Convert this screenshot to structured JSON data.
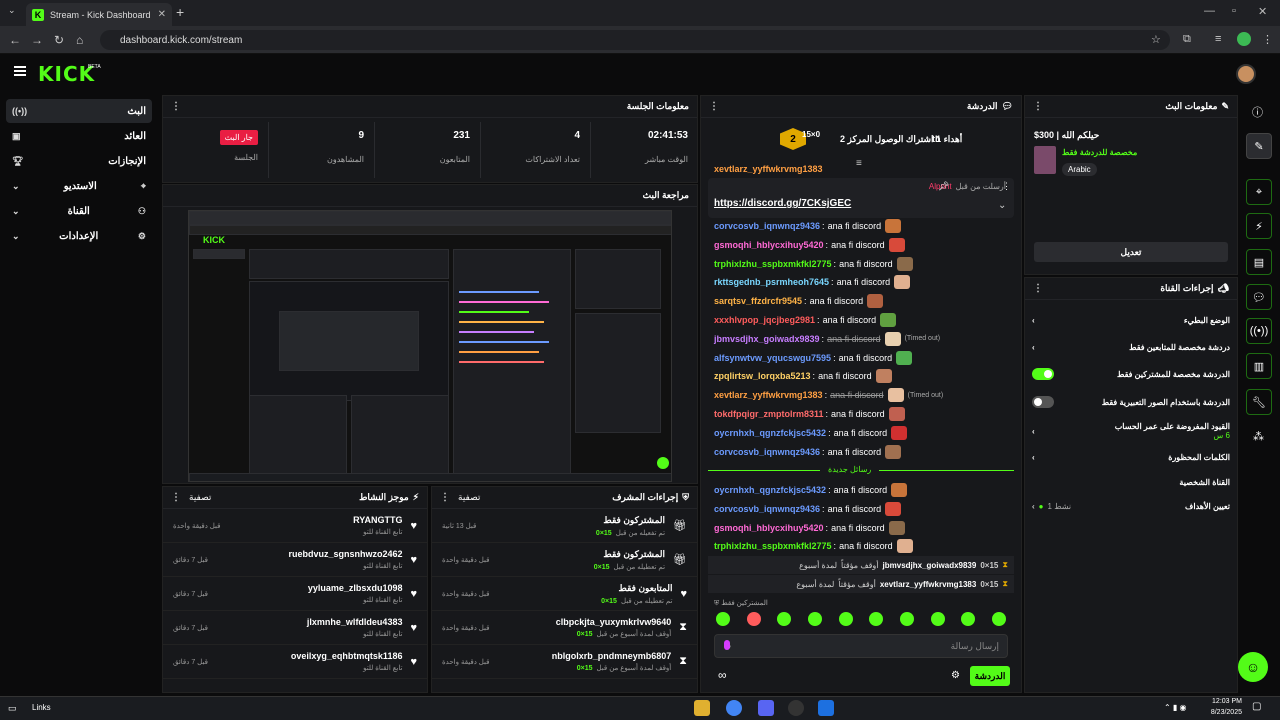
{
  "browser": {
    "tab_title": "Stream - Kick Dashboard",
    "url": "dashboard.kick.com/stream"
  },
  "app": {
    "logo": "KICK",
    "beta": "BETA"
  },
  "sidebar": {
    "items": [
      {
        "label": "البث",
        "icon": "broadcast-icon"
      },
      {
        "label": "العائد",
        "icon": "wallet-icon"
      },
      {
        "label": "الإنجازات",
        "icon": "trophy-icon"
      },
      {
        "label": "الاستديو",
        "icon": "studio-icon"
      },
      {
        "label": "القناة",
        "icon": "channel-icon"
      },
      {
        "label": "الإعدادات",
        "icon": "gear-icon"
      }
    ]
  },
  "session": {
    "title": "معلومات الجلسة",
    "live_badge": "جار البث",
    "stats": [
      {
        "value": "",
        "label": "الجلسة"
      },
      {
        "value": "9",
        "label": "المشاهدون"
      },
      {
        "value": "231",
        "label": "المتابعون"
      },
      {
        "value": "4",
        "label": "تعداد الاشتراكات"
      },
      {
        "value": "02:41:53",
        "label": "الوقت مباشر"
      }
    ]
  },
  "preview": {
    "title": "مراجعة البث"
  },
  "activity": {
    "title": "موجز النشاط",
    "filter": "تصفية",
    "rows": [
      {
        "name": "RYANGTTG",
        "sub": "تابع القناة للتو",
        "time": "قبل دقيقة واحدة"
      },
      {
        "name": "ruebdvuz_sgnsnhwzo2462",
        "sub": "تابع القناة للتو",
        "time": "قبل 7 دقائق"
      },
      {
        "name": "yyluame_zlbsxdu1098",
        "sub": "تابع القناة للتو",
        "time": "قبل 7 دقائق"
      },
      {
        "name": "jlxmnhe_wlfdldeu4383",
        "sub": "تابع القناة للتو",
        "time": "قبل 7 دقائق"
      },
      {
        "name": "oveilxyg_eqhbtmqtsk1186",
        "sub": "تابع القناة للتو",
        "time": "قبل 7 دقائق"
      }
    ]
  },
  "modactions": {
    "title": "إجراءات المشرف",
    "filter": "تصفية",
    "rows": [
      {
        "name": "المشتركون فقط",
        "tag": "15×0",
        "sub": "تم تفعيله من قبل",
        "time": "قبل 13 ثانية",
        "icon": "gift-icon"
      },
      {
        "name": "المشتركون فقط",
        "tag": "15×0",
        "sub": "تم تعطيله من قبل",
        "time": "قبل دقيقة واحدة",
        "icon": "gift-icon"
      },
      {
        "name": "المتابعون فقط",
        "tag": "15×0",
        "sub": "تم تعطيله من قبل",
        "time": "قبل دقيقة واحدة",
        "icon": "heart-icon"
      },
      {
        "name": "clbpckjta_yuxymkrlvw9640",
        "tag": "15×0",
        "sub": "أوقف لمدة أسبوع من قبل",
        "time": "قبل دقيقة واحدة",
        "icon": "hourglass-icon"
      },
      {
        "name": "nblgolxrb_pndmneymb6807",
        "tag": "15×0",
        "sub": "أوقف لمدة أسبوع من قبل",
        "time": "قبل دقيقة واحدة",
        "icon": "hourglass-icon"
      }
    ]
  },
  "chat": {
    "title": "الدردشة",
    "goal_text": "أهداء 1 اشتراك الوصول المركز 2",
    "goal_level": "2",
    "goal_tag": "15×0",
    "goal_suffix": "th",
    "pinned_by": "أرسلت من قبل",
    "pinned_user": "Alpont",
    "pinned_link": "https://discord.gg/7CKsjGEC",
    "message_text": "ana fi discord",
    "timed_out": "(Timed out)",
    "messages": [
      {
        "user": "corvcosvb_iqnwnqz9436",
        "color": "#6c9bff"
      },
      {
        "user": "gsmoqhi_hblycxihuy5420",
        "color": "#ff6ad5"
      },
      {
        "user": "trphixlzhu_sspbxmkfkl2775",
        "color": "#53fc18"
      },
      {
        "user": "rkttsgednb_psrmheoh7645",
        "color": "#7ad7ff"
      },
      {
        "user": "sarqtsv_ffzdrcfr9545",
        "color": "#ffb347"
      },
      {
        "user": "xxxhlvpop_jqcjbeg2981",
        "color": "#ff5c5c"
      },
      {
        "user": "jbmvsdjhx_goiwadx9839",
        "color": "#c77dff"
      },
      {
        "user": "alfsynwtvw_yqucswgu7595",
        "color": "#6c9bff"
      },
      {
        "user": "zpqlirtsw_lorqxba5213",
        "color": "#ffd166"
      },
      {
        "user": "xevtlarz_yyffwkrvmg1383",
        "color": "#ff9f43"
      },
      {
        "user": "tokdfpqigr_zmptolrm8311",
        "color": "#ff6b6b"
      },
      {
        "user": "oycrnhxh_qgnzfckjsc5432",
        "color": "#6c9bff"
      },
      {
        "user": "corvcosvb_iqnwnqz9436",
        "color": "#6c9bff"
      }
    ],
    "new_messages": "رسائل جديدة",
    "messages_new": [
      {
        "user": "oycrnhxh_qgnzfckjsc5432",
        "color": "#6c9bff"
      },
      {
        "user": "corvcosvb_iqnwnqz9436",
        "color": "#6c9bff"
      },
      {
        "user": "gsmoqhi_hblycxihuy5420",
        "color": "#ff6ad5"
      },
      {
        "user": "trphixlzhu_sspbxmkfkl2775",
        "color": "#53fc18"
      }
    ],
    "sys1": {
      "text": "أوقف مؤقتاً",
      "user": "jbmvsdjhx_goiwadx9839",
      "dur": "لمدة أسبوع",
      "tag": "15×0"
    },
    "sys2": {
      "text": "أوقف مؤقتاً",
      "user": "xevtlarz_yyffwkrvmg1383",
      "dur": "لمدة أسبوع",
      "tag": "15×0"
    },
    "subs_only": "المشتركين فقط",
    "placeholder": "إرسال رسالة",
    "send": "الدردشة",
    "top_user": "xevtlarz_yyffwkrvmg1383"
  },
  "stream_info": {
    "title": "معلومات البث",
    "stream_title": "حيلكم الله | 300$",
    "category": "مخصصة للدردشة فقط",
    "language": "Arabic",
    "edit": "تعديل"
  },
  "channel_actions": {
    "title": "إجراءات القناة",
    "rows": [
      {
        "label": "الوضع البطيء",
        "type": "arrow"
      },
      {
        "label": "دردشة مخصصة للمتابعين فقط",
        "type": "arrow"
      },
      {
        "label": "الدردشة مخصصة للمشتركين فقط",
        "type": "toggle",
        "on": true
      },
      {
        "label": "الدردشة باستخدام الصور التعبيرية فقط",
        "type": "toggle",
        "on": false
      },
      {
        "label": "القيود المفروضة على عمر الحساب",
        "sub": "6 س",
        "type": "arrow"
      },
      {
        "label": "الكلمات المحظورة",
        "type": "arrow"
      }
    ],
    "personal": "القناة الشخصية",
    "goals": "تعيين الأهداف",
    "goals_status": "نشط 1"
  },
  "taskbar": {
    "links": "Links",
    "time": "12:03 PM",
    "date": "8/23/2025"
  }
}
